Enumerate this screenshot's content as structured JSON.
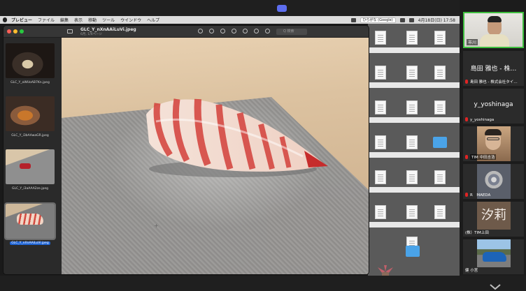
{
  "menubar": {
    "app": "プレビュー",
    "items": [
      "ファイル",
      "編集",
      "表示",
      "移動",
      "ツール",
      "ウインドウ",
      "ヘルプ"
    ],
    "input_source": "ひらがな (Google)",
    "datetime": "4月18日(日) 17:58"
  },
  "preview_window": {
    "title": "GLC_Y_nXnAAiLuVi.jpeg",
    "subtitle": "6月, 1/4ページ",
    "search_placeholder": "Q 検索",
    "thumbnails": [
      {
        "caption": "GLC_Y_aWUoAB7Kn.jpeg",
        "selected": false
      },
      {
        "caption": "GLC_Y_i3bAAwaGR.jpeg",
        "selected": false
      },
      {
        "caption": "GLC_Y_i3aAAA2ze.jpeg",
        "selected": false
      },
      {
        "caption": "GLC_Y_nXnAAiLuVi.jpeg",
        "selected": true
      }
    ]
  },
  "participants": {
    "tiles": [
      {
        "name": "市川",
        "type": "video"
      },
      {
        "display_name": "島田 雅也 - 株…",
        "label": "島田 雅也 - 株式会社タイ…",
        "type": "name",
        "muted": true
      },
      {
        "display_name": "y_yoshinaga",
        "label": "y_yoshinaga",
        "type": "name",
        "muted": true
      },
      {
        "label": "TIM 中田吉浩",
        "type": "video",
        "muted": true
      },
      {
        "label": "R　MAEDA",
        "type": "video",
        "muted": true
      },
      {
        "avatar_text": "汐莉",
        "label": "(株）TIM上田",
        "type": "avatar",
        "muted": false
      },
      {
        "label": "健 小宮",
        "type": "video",
        "muted": false
      }
    ]
  },
  "colors": {
    "mute": "#e02424",
    "selection": "#1e64d6",
    "folder": "#4aa3e8"
  }
}
